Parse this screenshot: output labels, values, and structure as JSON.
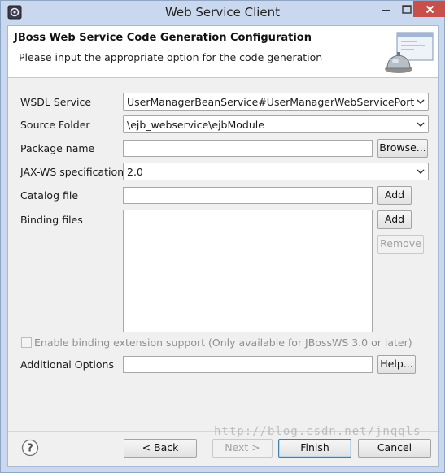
{
  "window": {
    "title": "Web Service Client"
  },
  "banner": {
    "title": "JBoss Web Service Code Generation Configuration",
    "description": "Please input the appropriate option for the code generation"
  },
  "form": {
    "wsdl_service": {
      "label": "WSDL Service",
      "value": "UserManagerBeanService#UserManagerWebServicePort"
    },
    "source_folder": {
      "label": "Source Folder",
      "value": "\\ejb_webservice\\ejbModule"
    },
    "package_name": {
      "label": "Package name",
      "value": "",
      "button": "Browse..."
    },
    "jaxws_spec": {
      "label": "JAX-WS specification",
      "value": "2.0"
    },
    "catalog_file": {
      "label": "Catalog file",
      "value": "",
      "button": "Add"
    },
    "binding_files": {
      "label": "Binding files",
      "add_button": "Add",
      "remove_button": "Remove"
    },
    "binding_extension": {
      "label": "Enable binding extension support (Only available for JBossWS 3.0 or later)",
      "checked": false,
      "enabled": false
    },
    "additional_options": {
      "label": "Additional Options",
      "value": "",
      "button": "Help..."
    }
  },
  "footer": {
    "back": "< Back",
    "next": "Next >",
    "finish": "Finish",
    "cancel": "Cancel"
  },
  "watermark": "http://blog.csdn.net/jnqqls",
  "colors": {
    "titlebar": "#c9d8ee",
    "close_button": "#c7504b",
    "default_button_border": "#3c7fb1"
  },
  "icons": [
    "app-icon",
    "minimize-icon",
    "maximize-icon",
    "close-icon",
    "wizard-banner-icon",
    "chevron-down-icon",
    "help-icon"
  ]
}
